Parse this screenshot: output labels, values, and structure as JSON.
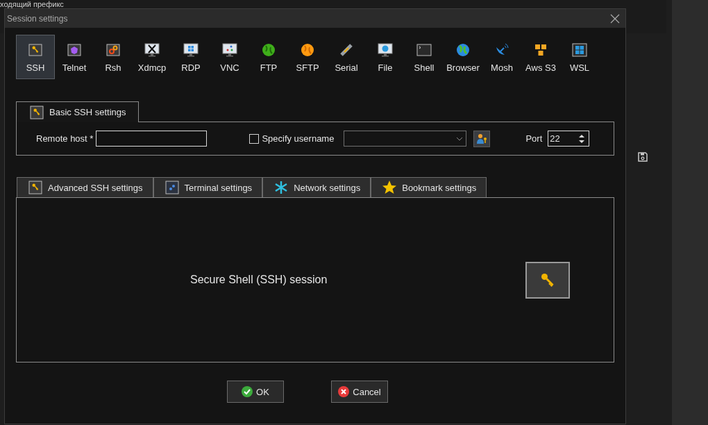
{
  "background_text": "ходящий префикс",
  "window": {
    "title": "Session settings"
  },
  "protocols": [
    {
      "label": "SSH",
      "selected": true
    },
    {
      "label": "Telnet",
      "selected": false
    },
    {
      "label": "Rsh",
      "selected": false
    },
    {
      "label": "Xdmcp",
      "selected": false
    },
    {
      "label": "RDP",
      "selected": false
    },
    {
      "label": "VNC",
      "selected": false
    },
    {
      "label": "FTP",
      "selected": false
    },
    {
      "label": "SFTP",
      "selected": false
    },
    {
      "label": "Serial",
      "selected": false
    },
    {
      "label": "File",
      "selected": false
    },
    {
      "label": "Shell",
      "selected": false
    },
    {
      "label": "Browser",
      "selected": false
    },
    {
      "label": "Mosh",
      "selected": false
    },
    {
      "label": "Aws S3",
      "selected": false
    },
    {
      "label": "WSL",
      "selected": false
    }
  ],
  "basic_tab": {
    "label": "Basic SSH settings"
  },
  "remote_host": {
    "label": "Remote host *"
  },
  "specify_username": {
    "label": "Specify username",
    "checked": false
  },
  "port": {
    "label": "Port",
    "value": "22"
  },
  "settings_tabs": [
    {
      "label": "Advanced SSH settings",
      "selected": false
    },
    {
      "label": "Terminal settings",
      "selected": false
    },
    {
      "label": "Network settings",
      "selected": false
    },
    {
      "label": "Bookmark settings",
      "selected": false
    }
  ],
  "description": "Secure Shell (SSH) session",
  "buttons": [
    {
      "label": "OK",
      "kind": "ok"
    },
    {
      "label": "Cancel",
      "kind": "cancel"
    }
  ]
}
